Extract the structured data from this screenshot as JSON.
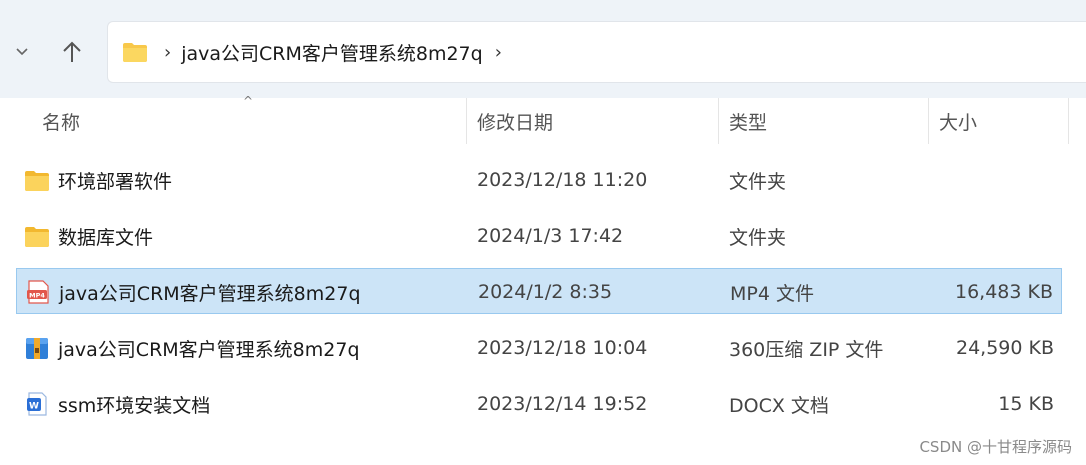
{
  "address": {
    "path_segment": "java公司CRM客户管理系统8m27q",
    "separator": "›",
    "trailing_separator": "›"
  },
  "header": {
    "name": "名称",
    "date": "修改日期",
    "type": "类型",
    "size": "大小",
    "sort_indicator": "^"
  },
  "files": [
    {
      "name": "环境部署软件",
      "date": "2023/12/18 11:20",
      "type": "文件夹",
      "size": "",
      "icon": "folder-icon",
      "selected": false
    },
    {
      "name": "数据库文件",
      "date": "2024/1/3 17:42",
      "type": "文件夹",
      "size": "",
      "icon": "folder-icon",
      "selected": false
    },
    {
      "name": "java公司CRM客户管理系统8m27q",
      "date": "2024/1/2 8:35",
      "type": "MP4 文件",
      "size": "16,483 KB",
      "icon": "mp4-file-icon",
      "icon_label": "MP4",
      "selected": true
    },
    {
      "name": "java公司CRM客户管理系统8m27q",
      "date": "2023/12/18 10:04",
      "type": "360压缩 ZIP 文件",
      "size": "24,590 KB",
      "icon": "zip-archive-icon",
      "selected": false
    },
    {
      "name": "ssm环境安装文档",
      "date": "2023/12/14 19:52",
      "type": "DOCX 文档",
      "size": "15 KB",
      "icon": "docx-file-icon",
      "icon_label": "W",
      "selected": false
    }
  ],
  "watermark": "CSDN @十甘程序源码",
  "colors": {
    "selection_bg": "#cce4f7",
    "selection_border": "#99c9ef",
    "folder_yellow": "#f8c84a",
    "docx_blue": "#2b6fd6",
    "mp4_red": "#e2574c"
  }
}
